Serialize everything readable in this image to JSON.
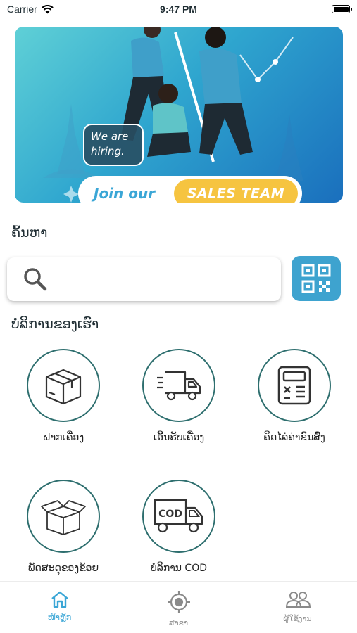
{
  "status_bar": {
    "carrier": "Carrier",
    "time": "9:47 PM"
  },
  "banner": {
    "hiring_line1": "We are",
    "hiring_line2": "hiring.",
    "join_text": "Join our",
    "sales_text": "SALES TEAM"
  },
  "search": {
    "title": "ຄົ້ນຫາ",
    "placeholder": ""
  },
  "services": {
    "title": "ບໍລິການຂອງເຮົາ",
    "items": [
      {
        "label": "ຝາກເຄື່ອງ",
        "icon": "box-icon"
      },
      {
        "label": "ເອີ້ນຮັບເຄື່ອງ",
        "icon": "truck-icon"
      },
      {
        "label": "ຄິດໄລ່ຄ່າຂົນສົ່ງ",
        "icon": "calculator-icon"
      },
      {
        "label": "ພັດສະດຸຂອງຂ້ອຍ",
        "icon": "open-box-icon"
      },
      {
        "label": "ບໍລິການ COD",
        "icon": "cod-truck-icon"
      }
    ],
    "cod_sign": "COD"
  },
  "tab_bar": {
    "tabs": [
      {
        "label": "ໜ້າຫຼັກ",
        "icon": "home-icon",
        "active": true
      },
      {
        "label": "ສາຂາ",
        "icon": "location-target-icon",
        "active": false
      },
      {
        "label": "ຜູ້ໃຊ້ງານ",
        "icon": "users-icon",
        "active": false
      }
    ]
  },
  "colors": {
    "accent": "#3ea3cf",
    "circle_border": "#2d6e6e",
    "sales_yellow": "#f6c440"
  }
}
